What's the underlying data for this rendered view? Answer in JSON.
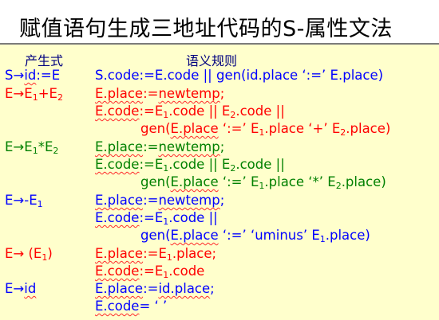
{
  "slide": {
    "title": "赋值语句生成三地址代码的S-属性文法",
    "header_production": "产生式",
    "header_rules": "语义规则"
  },
  "colors": {
    "background": "#ffffcc",
    "header": "#00007f",
    "blue": "#0000ff",
    "red": "#ff0000",
    "green": "#008000"
  },
  "rows": [
    {
      "production": {
        "a": "S→",
        "b": "id",
        "c": ":=E"
      },
      "rules": [
        {
          "a": "S.code",
          "b": ":=E.code || gen(id.place   ‘:=’   E.place)"
        }
      ]
    },
    {
      "production": {
        "a": "E→E",
        "s1": "1",
        "b": "+E",
        "s2": "2"
      },
      "rules": [
        {
          "a": "E.place",
          "b": ":=",
          "c": "newtemp",
          "d": ";"
        },
        {
          "a": "E.code",
          "b": ":=E",
          "s1": "1",
          "c": ".code || E",
          "s2": "2",
          "d": ".code ||"
        },
        {
          "a": "gen(",
          "b": "E.place",
          "c": "   ‘:=’   E",
          "s1": "1",
          "d": ".place   ‘+’   E",
          "s2": "2",
          "e": ".place)"
        }
      ]
    },
    {
      "production": {
        "a": "E→E",
        "s1": "1",
        "b": "*E",
        "s2": "2"
      },
      "rules": [
        {
          "a": "E.place",
          "b": ":=",
          "c": "newtemp",
          "d": ";"
        },
        {
          "a": "E.code",
          "b": ":=E",
          "s1": "1",
          "c": ".code || E",
          "s2": "2",
          "d": ".code ||"
        },
        {
          "a": "gen(",
          "b": "E.place",
          "c": "   ‘:=’   E",
          "s1": "1",
          "d": ".place   ‘*’   E",
          "s2": "2",
          "e": ".place)"
        }
      ]
    },
    {
      "production": {
        "a": "E→-E",
        "s1": "1"
      },
      "rules": [
        {
          "a": "E.place",
          "b": ":=",
          "c": "newtemp",
          "d": ";"
        },
        {
          "a": "E.code",
          "b": ":=E",
          "s1": "1",
          "c": ".code ||"
        },
        {
          "a": "gen(",
          "b": "E.place",
          "c": "   ‘:=’     ‘uminus’   E",
          "s1": "1",
          "d": ".place)"
        }
      ]
    },
    {
      "production": {
        "a": "E→ (E",
        "s1": "1",
        "b": ")"
      },
      "rules": [
        {
          "a": "E.place",
          "b": ":=E",
          "s1": "1",
          "c": ".place;"
        },
        {
          "a": "E.code",
          "b": ":=E",
          "s1": "1",
          "c": ".code"
        }
      ]
    },
    {
      "production": {
        "a": "E→",
        "b": "id"
      },
      "rules": [
        {
          "a": "E.place",
          "b": ":=",
          "c": "id.place",
          "d": ";"
        },
        {
          "a": "E.code",
          "b": "=   ‘ ’"
        }
      ]
    }
  ]
}
